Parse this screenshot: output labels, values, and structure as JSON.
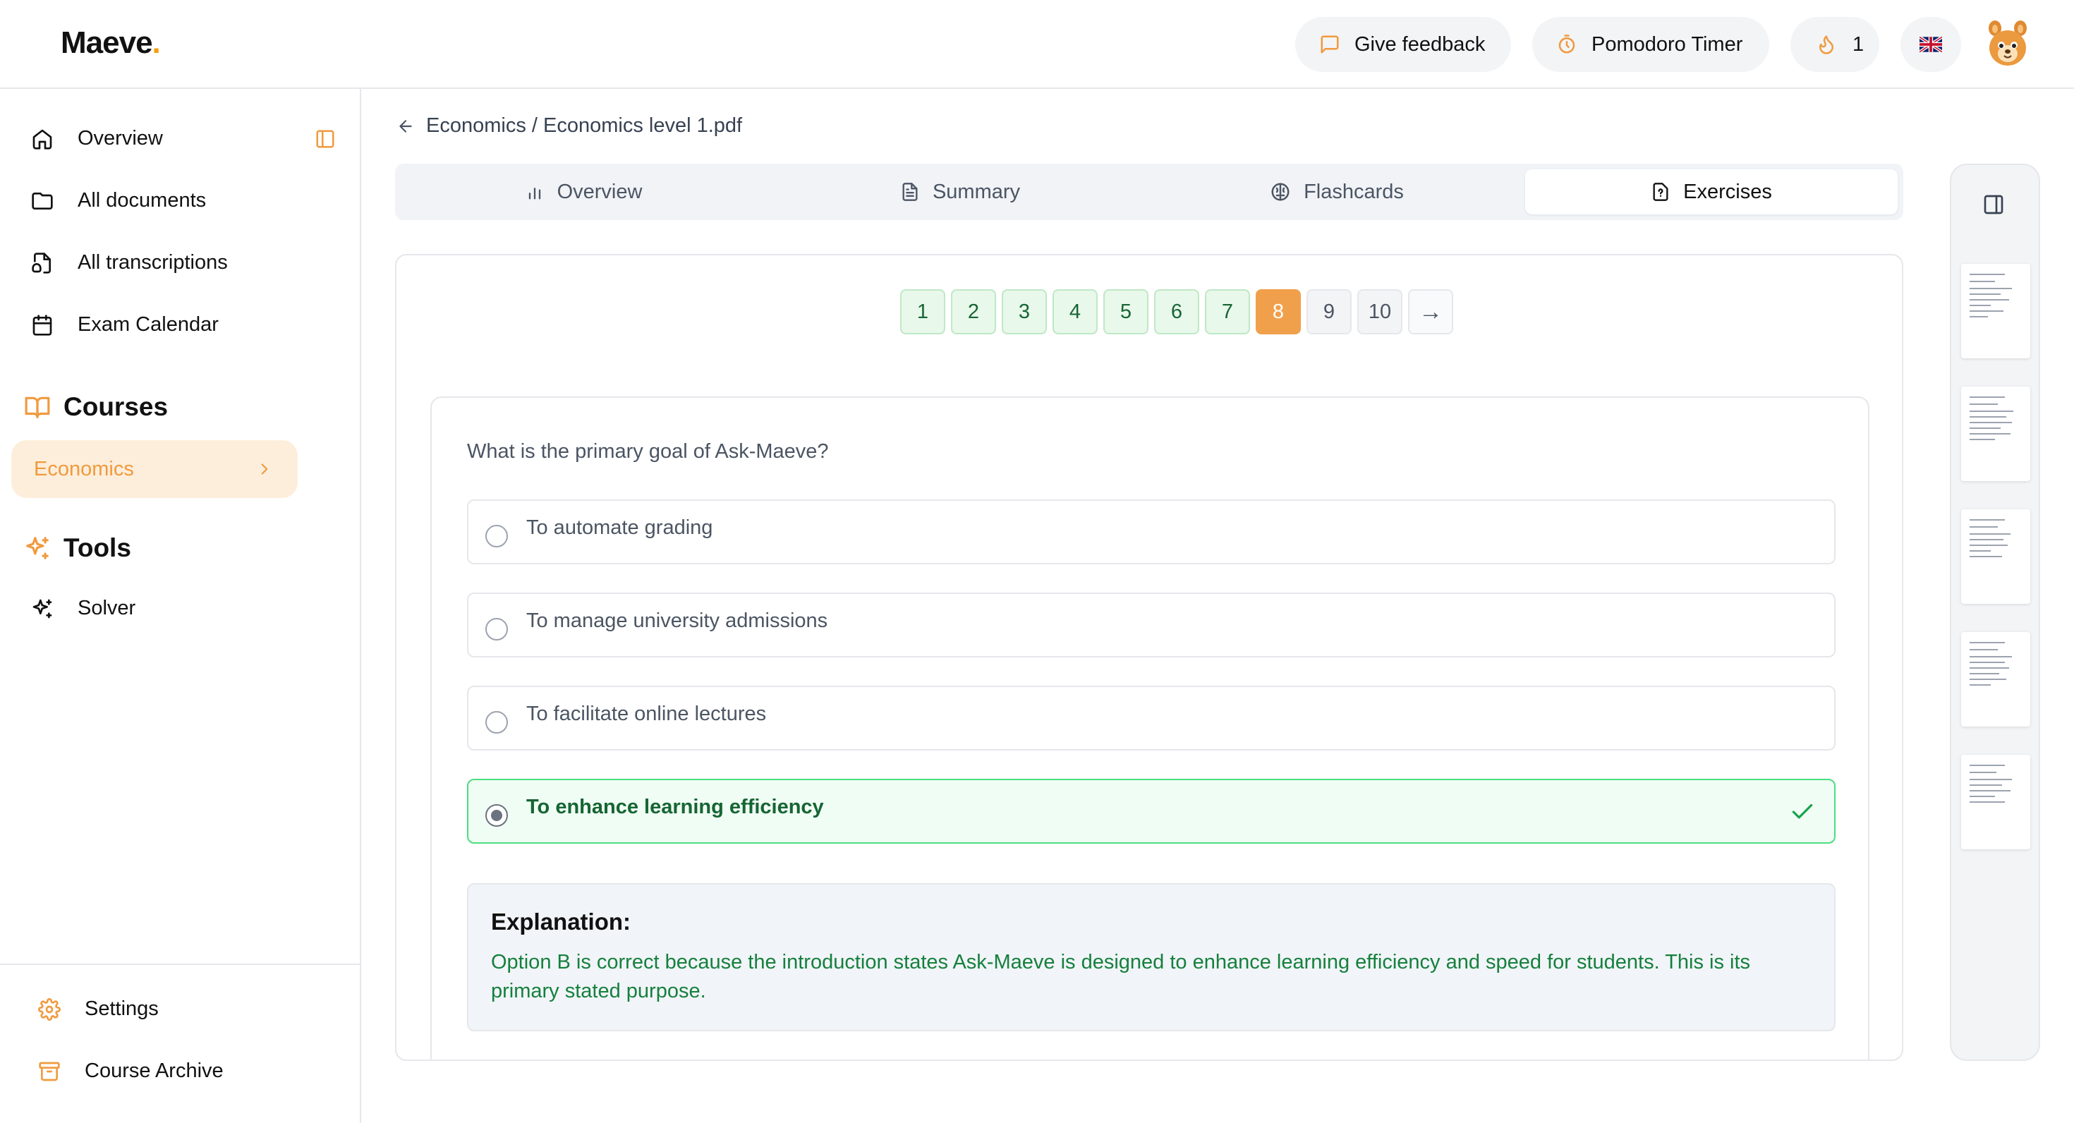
{
  "header": {
    "logo": "Maeve",
    "logo_dot": ".",
    "feedback_label": "Give feedback",
    "pomodoro_label": "Pomodoro Timer",
    "streak_count": "1",
    "language_flag": "🇬🇧"
  },
  "sidebar": {
    "nav": [
      {
        "label": "Overview",
        "icon": "home-icon"
      },
      {
        "label": "All documents",
        "icon": "folder-icon"
      },
      {
        "label": "All transcriptions",
        "icon": "transcription-icon"
      },
      {
        "label": "Exam Calendar",
        "icon": "calendar-icon"
      }
    ],
    "courses_title": "Courses",
    "courses": [
      {
        "label": "Economics"
      }
    ],
    "tools_title": "Tools",
    "tools": [
      {
        "label": "Solver",
        "icon": "sparkle-icon"
      }
    ],
    "bottom": [
      {
        "label": "Settings",
        "icon": "gear-icon"
      },
      {
        "label": "Course Archive",
        "icon": "archive-icon"
      }
    ]
  },
  "breadcrumb": "Economics / Economics level 1.pdf",
  "tabs": [
    {
      "label": "Overview",
      "icon": "chart-icon"
    },
    {
      "label": "Summary",
      "icon": "document-icon"
    },
    {
      "label": "Flashcards",
      "icon": "brain-icon"
    },
    {
      "label": "Exercises",
      "icon": "question-file-icon",
      "active": true
    }
  ],
  "pager": {
    "pages": [
      "1",
      "2",
      "3",
      "4",
      "5",
      "6",
      "7",
      "8",
      "9",
      "10"
    ],
    "current": "8",
    "next": "→"
  },
  "exercise": {
    "question": "What is the primary goal of Ask-Maeve?",
    "options": [
      {
        "label": "To automate grading"
      },
      {
        "label": "To manage university admissions"
      },
      {
        "label": "To facilitate online lectures"
      },
      {
        "label": "To enhance learning efficiency",
        "correct": true
      }
    ],
    "explanation_title": "Explanation:",
    "explanation_text": "Option B is correct because the introduction states Ask-Maeve is designed to enhance learning efficiency and speed for students. This is its primary stated purpose."
  },
  "colors": {
    "accent": "#f0a04b",
    "correct_green": "#166534",
    "course_bg": "#fdeedb"
  }
}
